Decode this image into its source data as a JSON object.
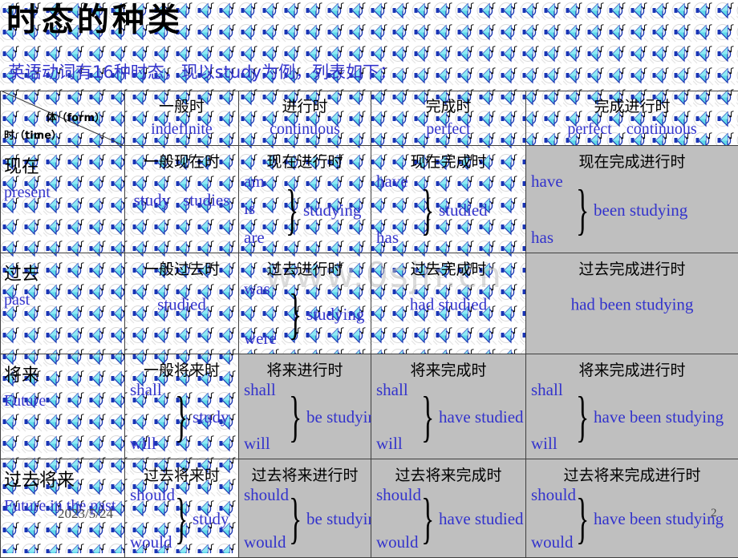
{
  "slide": {
    "title": "时态的种类",
    "subtitle": "英语动词有16种时态，现以study为例，列表如下：",
    "date": "2023/5/24",
    "page_number": "2",
    "watermark": "www.0sjn.cn",
    "colors": {
      "title": "#000000",
      "chinese": "#000000",
      "english": "#3333cc",
      "shaded_cell": "#bfbfbf",
      "border": "#404040",
      "footer": "#4a4a4a"
    },
    "background_icon": "speaker-music-note-icon"
  },
  "table": {
    "corner": {
      "form_label": "体（form）",
      "time_label": "时（time）"
    },
    "columns": [
      {
        "ch": "一般时",
        "en": "indefinite"
      },
      {
        "ch": "进行时",
        "en": "continuous"
      },
      {
        "ch": "完成时",
        "en": "perfect"
      },
      {
        "ch": "完成进行时",
        "en": "perfect",
        "en2": "continuous"
      }
    ],
    "rows": [
      {
        "label_ch": "现在",
        "label_en": "present",
        "cells": [
          {
            "head": "一般现在时",
            "type": "pair",
            "left": "study",
            "right": "studies",
            "shaded": false
          },
          {
            "head": "现在进行时",
            "type": "brace",
            "top": "am",
            "bottom": "are",
            "middle_upper": "is",
            "main": "studying",
            "shaded": false
          },
          {
            "head": "现在完成时",
            "type": "brace",
            "top": "have",
            "bottom": "has",
            "main": "studied",
            "shaded": false
          },
          {
            "head": "现在完成进行时",
            "type": "brace",
            "top": "have",
            "bottom": "has",
            "main": "been    studying",
            "shaded": true
          }
        ]
      },
      {
        "label_ch": "过去",
        "label_en": "past",
        "cells": [
          {
            "head": "一般过去时",
            "type": "single",
            "main": "studied",
            "shaded": false
          },
          {
            "head": "过去进行时",
            "type": "brace",
            "top": "was",
            "bottom": "were",
            "main": "studying",
            "shaded": false
          },
          {
            "head": "过去完成时",
            "type": "single",
            "main": "had    studied",
            "shaded": false
          },
          {
            "head": "过去完成进行时",
            "type": "single",
            "main": "had been studying",
            "shaded": true
          }
        ]
      },
      {
        "label_ch": "将来",
        "label_en": "Future",
        "cells": [
          {
            "head": "一般将来时",
            "type": "brace",
            "top": "shall",
            "bottom": "will",
            "main": "study",
            "shaded": false
          },
          {
            "head": "将来进行时",
            "type": "brace",
            "top": "shall",
            "bottom": "will",
            "main": "be studying",
            "shaded": true
          },
          {
            "head": "将来完成时",
            "type": "brace",
            "top": "shall",
            "bottom": "will",
            "main": "have studied",
            "shaded": true
          },
          {
            "head": "将来完成进行时",
            "type": "brace",
            "top": "shall",
            "bottom": "will",
            "main": "have been studying",
            "shaded": true
          }
        ]
      },
      {
        "label_ch": "过去将来",
        "label_en": "Future in the past",
        "cells": [
          {
            "head": "过去将来时",
            "type": "brace",
            "top": "should",
            "bottom": "would",
            "main": "study",
            "shaded": false
          },
          {
            "head": "过去将来进行时",
            "type": "brace",
            "top": "should",
            "bottom": "would",
            "main": "be studying",
            "shaded": true
          },
          {
            "head": "过去将来完成时",
            "type": "brace",
            "top": "should",
            "bottom": "would",
            "main": "have studied",
            "shaded": true
          },
          {
            "head": "过去将来完成进行时",
            "type": "brace",
            "top": "should",
            "bottom": "would",
            "main": "have been studying",
            "shaded": true
          }
        ]
      }
    ]
  }
}
